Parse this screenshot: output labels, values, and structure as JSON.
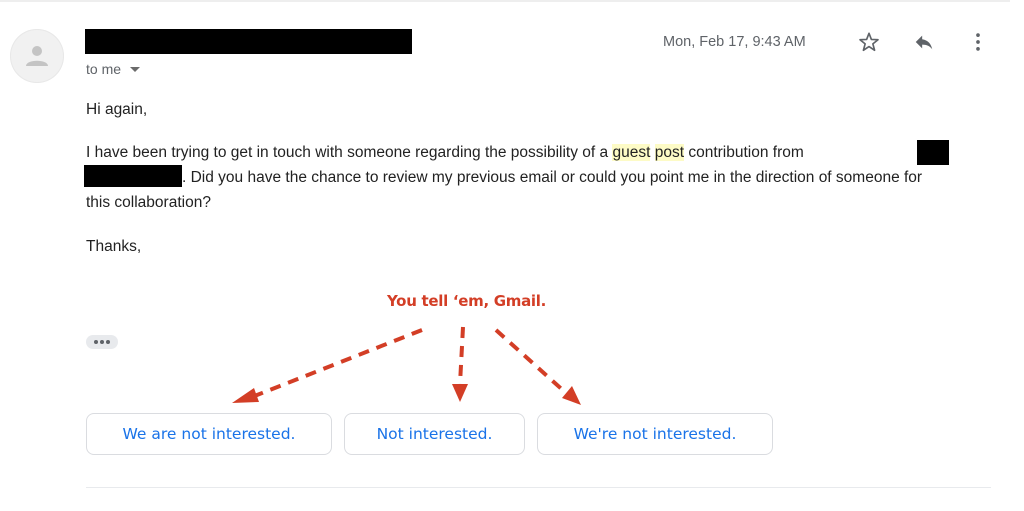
{
  "header": {
    "sender_redacted": true,
    "recipient_label": "to me",
    "date": "Mon, Feb 17, 9:43 AM",
    "actions": [
      {
        "name": "star",
        "icon": "star-outline-icon"
      },
      {
        "name": "reply",
        "icon": "reply-icon"
      },
      {
        "name": "more",
        "icon": "more-vert-icon"
      }
    ]
  },
  "message": {
    "greeting": "Hi again,",
    "para1_part1": "I have been trying to get in touch with someone regarding the possibility of a ",
    "highlight1": "guest",
    "space": " ",
    "highlight2": "post",
    "para1_part2": " contribution from ",
    "para1_part3": ". Did you have the chance to review my previous email or could you point me in the direction of someone for this collaboration?",
    "signoff": "Thanks,"
  },
  "annotation": {
    "text": "You tell ‘em, Gmail.",
    "color": "#d33e26"
  },
  "trimmed_content_icon": "ellipsis-icon",
  "smart_replies": [
    {
      "label": "We are not interested."
    },
    {
      "label": "Not interested."
    },
    {
      "label": "We're not interested."
    }
  ],
  "colors": {
    "accent": "#1a73e8",
    "highlight": "#fdfbc6",
    "secondary_text": "#5f6368"
  }
}
